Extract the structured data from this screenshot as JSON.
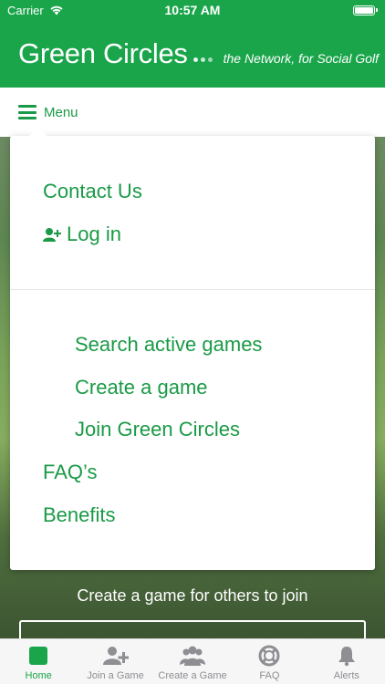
{
  "status_bar": {
    "carrier": "Carrier",
    "time": "10:57 AM"
  },
  "header": {
    "brand": "Green Circles",
    "tagline": "the Network, for Social Golf"
  },
  "menu_bar": {
    "label": "Menu"
  },
  "dropdown": {
    "items": [
      {
        "label": "Contact Us",
        "icon": "add-user-icon"
      },
      {
        "label": "Log in",
        "icon": "add-user-icon"
      },
      {
        "label": "Search active games"
      },
      {
        "label": "Create a game"
      },
      {
        "label": "Join Green Circles"
      },
      {
        "label": "FAQ’s"
      },
      {
        "label": "Benefits"
      }
    ]
  },
  "background": {
    "text": "Create a game for others to join"
  },
  "tabs": [
    {
      "label": "Home",
      "icon": "home-square-icon",
      "active": true
    },
    {
      "label": "Join a Game",
      "icon": "add-user-icon"
    },
    {
      "label": "Create a Game",
      "icon": "group-icon"
    },
    {
      "label": "FAQ",
      "icon": "lifebuoy-icon"
    },
    {
      "label": "Alerts",
      "icon": "bell-icon"
    }
  ],
  "colors": {
    "brand_green": "#1aa54b",
    "link_green": "#1a9a46",
    "tab_inactive": "#8e8e93"
  }
}
